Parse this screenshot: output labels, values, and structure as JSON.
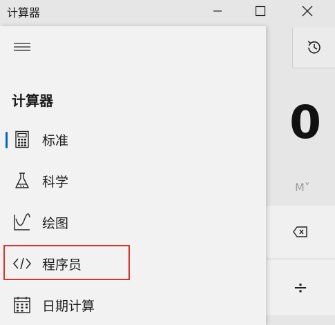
{
  "window": {
    "title": "计算器"
  },
  "calculator": {
    "display": "0",
    "memory_label": "M˅",
    "divide_symbol": "÷"
  },
  "nav": {
    "title": "计算器",
    "items": [
      {
        "label": "标准",
        "icon": "calculator-icon",
        "selected": true
      },
      {
        "label": "科学",
        "icon": "flask-icon",
        "selected": false
      },
      {
        "label": "绘图",
        "icon": "graph-icon",
        "selected": false
      },
      {
        "label": "程序员",
        "icon": "code-icon",
        "selected": false
      },
      {
        "label": "日期计算",
        "icon": "calendar-icon",
        "selected": false
      }
    ]
  },
  "colors": {
    "accent": "#0067c0",
    "highlight": "#d9342b",
    "pane_bg": "#f2f2f2",
    "window_bg": "#e6e6e6"
  }
}
